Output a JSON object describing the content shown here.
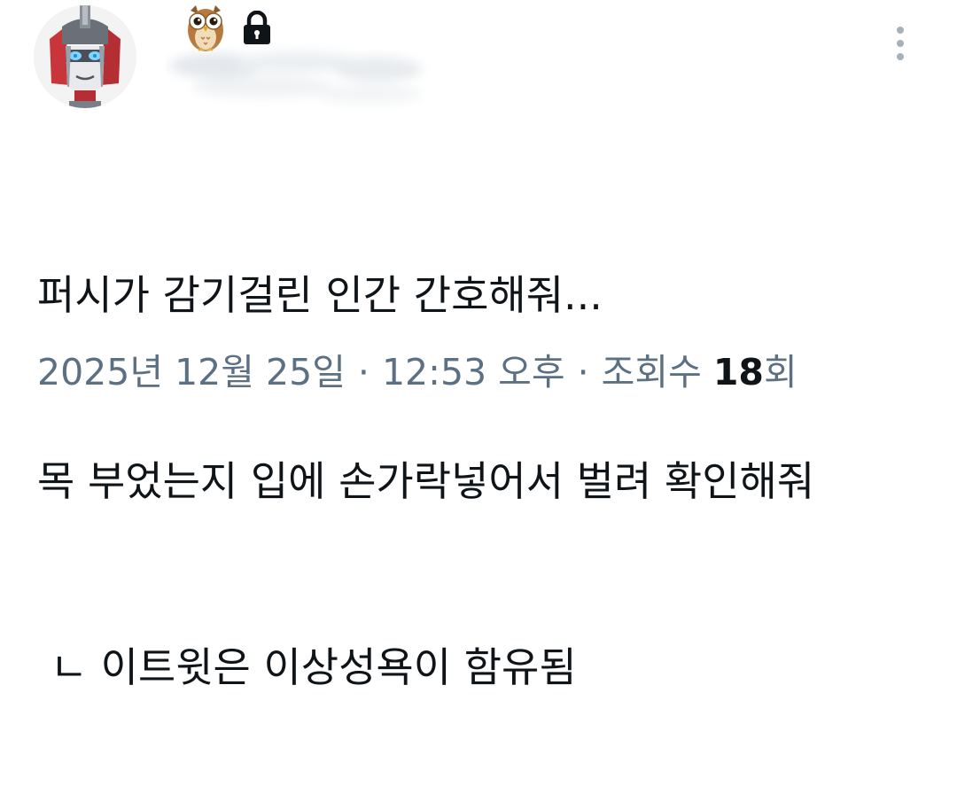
{
  "tweet": {
    "author": {
      "avatar_icon": "robot-avatar-icon",
      "badge_icon": "owl-emoji-icon",
      "protected_icon": "lock-icon"
    },
    "text_lines": [
      "퍼시가 감기걸린 인간 간호해줘...",
      "목 부었는지 입에 손가락넣어서 벌려 확인해줘",
      " ㄴ 이트윗은 이상성욕이 함유됨"
    ],
    "meta": {
      "date": "2025년 12월 25일",
      "separator": "·",
      "time": "12:53 오후",
      "views_label": "조회수",
      "views_count": "18",
      "views_suffix": "회"
    },
    "more_button_icon": "more-vertical-icon"
  }
}
